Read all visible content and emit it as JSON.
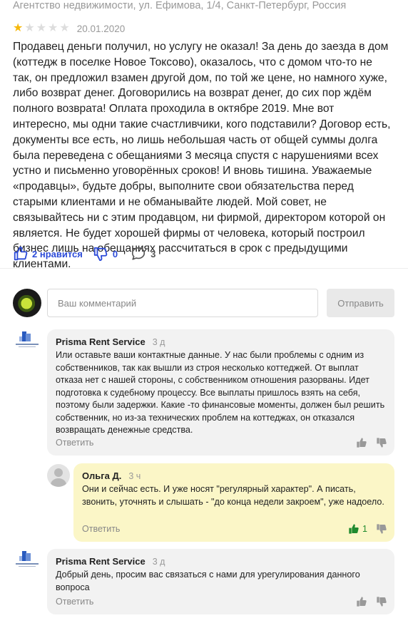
{
  "review": {
    "org_line": "Агентство недвижимости, ул. Ефимова, 1/4, Санкт-Петербург, Россия",
    "rating": 1,
    "rating_max": 5,
    "date": "20.01.2020",
    "text": "Продавец деньги получил, но услугу не оказал! За день до заезда в дом (коттедж в поселке Новое Токсово), оказалось, что с домом что-то не так, он предложил взамен другой дом, по той же цене, но намного хуже, либо возврат денег. Договорились на возврат денег, до сих пор ждём полного возврата! Оплата проходила в октябре 2019. Мне вот интересно, мы одни такие счастливчики, кого подставили? Договор есть, документы все есть, но лишь небольшая часть от общей суммы долга была переведена с обещаниями 3 месяца спустя с нарушениями всех устно и письменно уговорённых сроков! И вновь тишина. Уважаемые «продавцы», будьте добры, выполните свои обязательства перед старыми клиентами и не обманывайте людей. Мой совет, не связывайтесь ни с этим продавцом, ни фирмой, директором которой он является. Не будет хорошей фирмы от человека, который построил бизнес лишь на обещаниях рассчитаться в срок с предыдущими клиентами.",
    "likes_label": "2 нравится",
    "dislikes": "0",
    "comments": "3"
  },
  "comment_form": {
    "placeholder": "Ваш комментарий",
    "send_label": "Отправить"
  },
  "comments": [
    {
      "author": "Prisma Rent Service",
      "time": "3 д",
      "text": "Или оставьте ваши контактные данные. У нас были проблемы с одним из собственников, так как вышли из строя несколько коттеджей. От выплат отказа нет с нашей стороны, с собственником отношения разорваны. Идет подготовка к судебному процессу. Все выплаты пришлось взять на себя, поэтому были задержки. Какие -то финансовые моменты, должен был решить собственник, но из-за технических проблем на коттеджах, он отказался возвращать денежные средства.",
      "reply_label": "Ответить",
      "likes": ""
    },
    {
      "author": "Ольга Д.",
      "time": "3 ч",
      "text": "Они и сейчас есть. И уже носят \"регулярный характер\". А писать, звонить, уточнять и слышать - \"до конца недели закроем\", уже надоело.",
      "reply_label": "Ответить",
      "likes": "1"
    },
    {
      "author": "Prisma Rent Service",
      "time": "3 д",
      "text": "Добрый день, просим вас связаться с нами для урегулирования данного вопроса",
      "reply_label": "Ответить",
      "likes": ""
    }
  ],
  "colors": {
    "accent": "#2c4bd8",
    "star": "#f6b80b",
    "highlight_bubble": "#fbf6c7",
    "bubble": "#f2f2f2",
    "like_active": "#1f8a2e"
  },
  "icons": [
    "thumb-up-icon",
    "thumb-down-icon",
    "comment-icon",
    "prisma-logo",
    "user-avatar"
  ]
}
